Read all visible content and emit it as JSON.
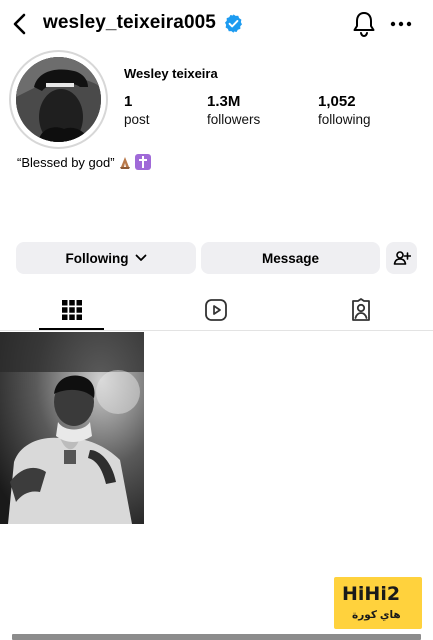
{
  "header": {
    "username": "wesley_teixeira005",
    "back_icon": "chevron-left-icon",
    "verified_icon": "verified-badge-icon",
    "notifications_icon": "bell-icon",
    "more_icon": "more-horizontal-icon"
  },
  "profile": {
    "display_name": "Wesley teixeira",
    "stats": {
      "posts": {
        "value": "1",
        "label": "post"
      },
      "followers": {
        "value": "1.3M",
        "label": "followers"
      },
      "following": {
        "value": "1,052",
        "label": "following"
      }
    },
    "bio": "“Blessed by god”",
    "bio_emojis": [
      "folded-hands-emoji",
      "latin-cross-emoji"
    ]
  },
  "actions": {
    "following_label": "Following",
    "message_label": "Message",
    "add_friend_icon": "person-add-icon"
  },
  "tabs": [
    {
      "name": "posts-grid",
      "icon": "grid-icon",
      "active": true
    },
    {
      "name": "reels",
      "icon": "reels-icon",
      "active": false
    },
    {
      "name": "tagged",
      "icon": "tagged-person-icon",
      "active": false
    }
  ],
  "posts_count_shown": 1,
  "watermark": {
    "logo": "HiHi2",
    "subtitle": "هاي كورة"
  },
  "colors": {
    "verified": "#1d9bf0",
    "button_bg": "#efeff2",
    "watermark": "#ffd23d"
  }
}
